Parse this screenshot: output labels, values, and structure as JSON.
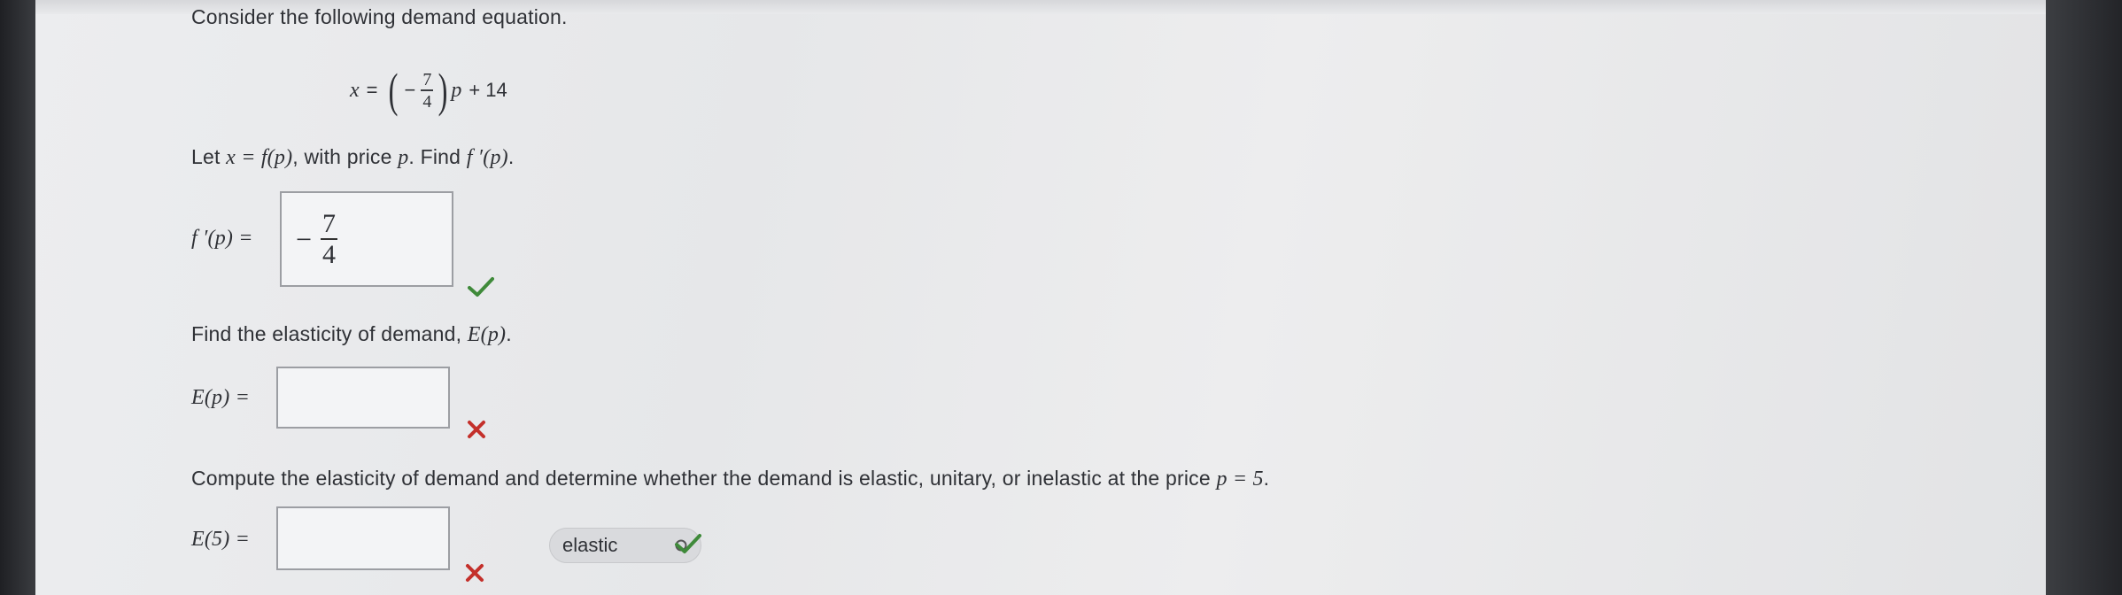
{
  "intro": "Consider the following demand equation.",
  "equation": {
    "lhs": "x",
    "equals": "=",
    "open_paren": "(",
    "sign": "−",
    "numerator": "7",
    "denominator": "4",
    "close_paren": ")",
    "variable": "p",
    "tail": "+ 14"
  },
  "q1": {
    "prompt_pre": "Let",
    "x_eq": "x = f(p)",
    "prompt_mid": ", with price",
    "p_var": "p",
    "prompt_post": ". Find",
    "fprime": "f ′(p)",
    "period": ".",
    "answer_label": "f ′(p) =",
    "answer_sign": "−",
    "answer_numerator": "7",
    "answer_denominator": "4",
    "status": "correct"
  },
  "q2": {
    "prompt_pre": "Find the elasticity of demand,",
    "ep": "E(p)",
    "period": ".",
    "answer_label": "E(p) =",
    "answer_value": "",
    "status": "incorrect"
  },
  "q3": {
    "prompt_pre": "Compute the elasticity of demand and determine whether the demand is elastic, unitary, or inelastic at the price",
    "price_eq": "p = 5",
    "period": ".",
    "answer_label": "E(5) =",
    "answer_value": "",
    "answer_status": "incorrect",
    "select_value": "elastic",
    "select_status": "correct"
  },
  "colors": {
    "correct": "#3f8a3a",
    "incorrect": "#c4302b"
  }
}
